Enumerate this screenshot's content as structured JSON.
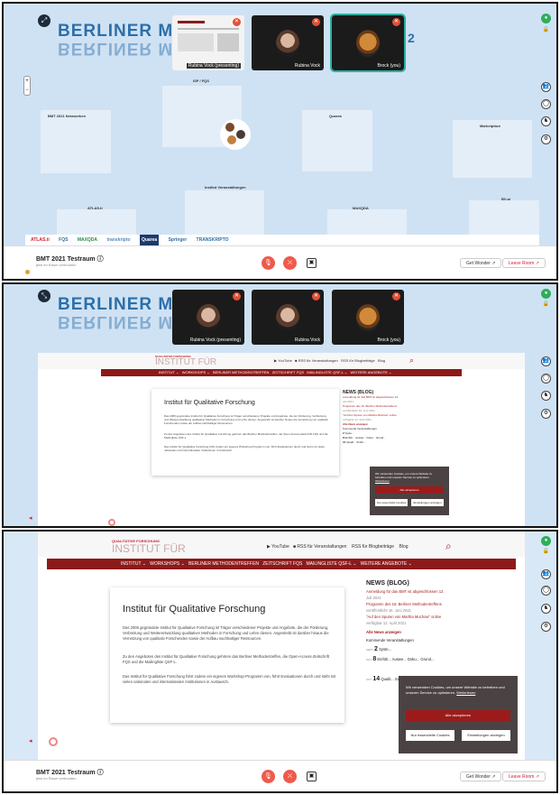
{
  "banner_text": "BERLINER METHO",
  "participants": [
    {
      "name": "Rubina Vock (presenting)"
    },
    {
      "name": "Rubina Vock"
    },
    {
      "name": "Brock (you)"
    }
  ],
  "zones": [
    "ISP / FQS",
    "BMT 2021 Netzwerken",
    "Quarea",
    "Marketplace",
    "Institut Veranstaltungen",
    "ATLAS.ti",
    "MAXQDA",
    "Sponsor",
    "BV-ai"
  ],
  "logos": [
    "ATLAS.ti",
    "FQS",
    "MAXQDA",
    "transkripto",
    "Quarea",
    "Springer",
    "TRANSKRIPTO"
  ],
  "room": {
    "title": "BMT 2021 Testraum",
    "subtitle": "jetzt im Raum verbunden"
  },
  "buttons": {
    "get_wonder": "Get Wonder",
    "leave_room": "Leave Room"
  },
  "website": {
    "logo_top": "QUALITATIVE FORSCHUNG",
    "logo_main": "INSTITUT FÜR",
    "top_links": [
      "YouTube",
      "RSS für Veranstaltungen",
      "RSS für Blogbeiträge",
      "Blog"
    ],
    "nav": [
      "INSTITUT ⌄",
      "WORKSHOPS ⌄",
      "BERLINER METHODENTREFFEN",
      "ZEITSCHRIFT FQS",
      "MAILINGLISTE QSF-L ⌄",
      "WEITERE ANGEBOTE ⌄"
    ],
    "heading": "Institut für Qualitative Forschung",
    "paragraphs": [
      "Das 2005 gegründete Institut für Qualitative Forschung ist Träger verschiedener Projekte und Angebote, die der Förderung, Verbreitung und Weiterentwicklung qualitativer Methoden in Forschung und Lehre dienen. Angestrebt ist darüber hinaus die Vernetzung von qualitativ Forschenden sowie der Aufbau nachhaltiger Ressourcen.",
      "Zu den Angeboten des Institut für Qualitative Forschung gehören das Berliner Methodentreffen, die Open-Access-Zeitschrift FQS und die Mailingliste QSF-L.",
      "Das Institut für Qualitative Forschung führt zudem ein eigenes Workshop-Programm von, führt Evaluationen durch und steht mit vielen nationalen und internationalen Institutionen in Austausch."
    ],
    "news_title": "NEWS (BLOG)",
    "news": [
      {
        "text": "Anmeldung für das BMT ist abgeschlossen 12.",
        "date": "Juli 2021"
      },
      {
        "text": "Programm des 16. Berliner Methodentreffens",
        "date": "veröffentlicht 16. Juni 2021"
      },
      {
        "text": "\"Auf den Spuren von Martha Muchow\" online",
        "date": "verfügbar 12. April 2021"
      }
    ],
    "all_news": "Alle News anzeigen",
    "upcoming": "Kommende Veranstaltungen",
    "events": [
      {
        "month": "SEPT",
        "day": "2",
        "text": "Syste..."
      },
      {
        "month": "OKT",
        "day": "8",
        "text": "Einfüh... Auswe... Doku... Grund..."
      },
      {
        "month": "OKT",
        "day": "14",
        "text": "Qualit... Schrit..."
      }
    ],
    "cookie": {
      "text": "Wir verwenden Cookies, um unsere Website zu betreiben und unseren Service zu optimieren.",
      "link": "Weiterlesen",
      "accept": "Alle akzeptieren",
      "essential": "Nur essenzielle Cookies",
      "settings": "Einstellungen anzeigen"
    }
  }
}
